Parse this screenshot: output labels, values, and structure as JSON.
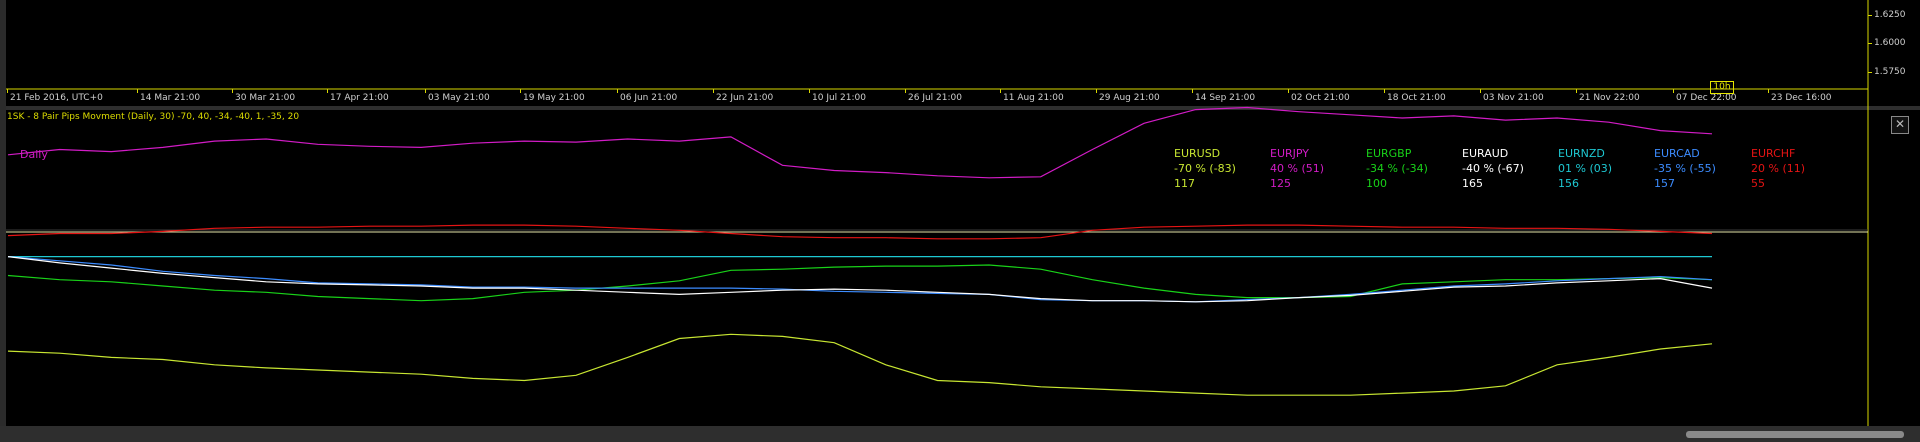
{
  "price_axis": {
    "labels": [
      "1.6250",
      "1.6000",
      "1.5750"
    ]
  },
  "time_axis": {
    "labels": [
      "21 Feb 2016, UTC+0",
      "14 Mar 21:00",
      "30 Mar 21:00",
      "17 Apr 21:00",
      "03 May 21:00",
      "19 May 21:00",
      "06 Jun 21:00",
      "22 Jun 21:00",
      "10 Jul 21:00",
      "26 Jul 21:00",
      "11 Aug 21:00",
      "29 Aug 21:00",
      "14 Sep 21:00",
      "02 Oct 21:00",
      "18 Oct 21:00",
      "03 Nov 21:00",
      "21 Nov 22:00",
      "07 Dec 22:00",
      "23 Dec 16:00"
    ],
    "cursor_label": "10h"
  },
  "indicator": {
    "title": "1SK - 8 Pair Pips Movment (Daily, 30) -70, 40, -34, -40, 1, -35, 20",
    "timeframe_label": "Daily",
    "close_symbol": "✕"
  },
  "legend": [
    {
      "pair": "EURUSD",
      "pct": "-70 % (-83)",
      "pips": "117",
      "color": "#c8e632"
    },
    {
      "pair": "EURJPY",
      "pct": "40 % (51)",
      "pips": "125",
      "color": "#d21cc6"
    },
    {
      "pair": "EURGBP",
      "pct": "-34 % (-34)",
      "pips": "100",
      "color": "#19d219"
    },
    {
      "pair": "EURAUD",
      "pct": "-40 % (-67)",
      "pips": "165",
      "color": "#ffffff"
    },
    {
      "pair": "EURNZD",
      "pct": "01 % (03)",
      "pips": "156",
      "color": "#1ec8d2"
    },
    {
      "pair": "EURCAD",
      "pct": "-35 % (-55)",
      "pips": "157",
      "color": "#3c8cff"
    },
    {
      "pair": "EURCHF",
      "pct": "20 % (11)",
      "pips": "55",
      "color": "#e61414"
    }
  ],
  "chart_data": {
    "type": "line",
    "title": "1SK - 8 Pair Pips Movment (Daily, 30) -70, 40, -34, -40, 1, -35, 20",
    "series": [
      {
        "name": "EURJPY",
        "color": "#d21cc6",
        "values": [
          105,
          110,
          108,
          112,
          118,
          120,
          115,
          113,
          112,
          116,
          118,
          117,
          120,
          118,
          122,
          95,
          90,
          88,
          85,
          83,
          84,
          110,
          135,
          148,
          150,
          146,
          143,
          140,
          142,
          138,
          140,
          136,
          128,
          125
        ]
      },
      {
        "name": "EURCHF",
        "color": "#e61414",
        "values": [
          28,
          30,
          30,
          32,
          35,
          36,
          36,
          37,
          37,
          38,
          38,
          37,
          35,
          33,
          30,
          27,
          26,
          26,
          25,
          25,
          26,
          33,
          36,
          37,
          38,
          38,
          37,
          36,
          36,
          35,
          35,
          34,
          32,
          30
        ]
      },
      {
        "name": "EURNZD",
        "color": "#1ec8d2",
        "values": [
          8,
          8,
          8,
          8,
          8,
          8,
          8,
          8,
          8,
          8,
          8,
          8,
          8,
          8,
          8,
          8,
          8,
          8,
          8,
          8,
          8,
          8,
          8,
          8,
          8,
          8,
          8,
          8,
          8,
          8,
          8,
          8,
          8,
          8
        ]
      },
      {
        "name": "EURUSD",
        "color": "#c8e632",
        "values": [
          -82,
          -84,
          -88,
          -90,
          -95,
          -98,
          -100,
          -102,
          -104,
          -108,
          -110,
          -105,
          -88,
          -70,
          -66,
          -68,
          -74,
          -95,
          -110,
          -112,
          -116,
          -118,
          -120,
          -122,
          -124,
          -124,
          -124,
          -122,
          -120,
          -115,
          -95,
          -88,
          -80,
          -75
        ]
      },
      {
        "name": "EURGBP",
        "color": "#19d219",
        "values": [
          -10,
          -14,
          -16,
          -20,
          -24,
          -26,
          -30,
          -32,
          -34,
          -32,
          -26,
          -24,
          -20,
          -15,
          -5,
          -4,
          -2,
          -1,
          -1,
          0,
          -4,
          -14,
          -22,
          -28,
          -31,
          -31,
          -30,
          -18,
          -16,
          -14,
          -14,
          -13,
          -12,
          -14
        ]
      },
      {
        "name": "EURCAD",
        "color": "#3c8cff",
        "values": [
          8,
          4,
          0,
          -6,
          -10,
          -13,
          -17,
          -18,
          -19,
          -21,
          -21,
          -22,
          -22,
          -22,
          -22,
          -23,
          -25,
          -26,
          -27,
          -28,
          -33,
          -34,
          -34,
          -35,
          -33,
          -31,
          -28,
          -24,
          -20,
          -18,
          -15,
          -13,
          -11,
          -14
        ]
      },
      {
        "name": "EURAUD",
        "color": "#ffffff",
        "values": [
          8,
          2,
          -3,
          -8,
          -12,
          -16,
          -18,
          -19,
          -20,
          -22,
          -22,
          -24,
          -26,
          -28,
          -26,
          -24,
          -23,
          -24,
          -26,
          -28,
          -32,
          -34,
          -34,
          -35,
          -34,
          -31,
          -29,
          -25,
          -21,
          -20,
          -17,
          -15,
          -13,
          -22
        ]
      }
    ]
  }
}
